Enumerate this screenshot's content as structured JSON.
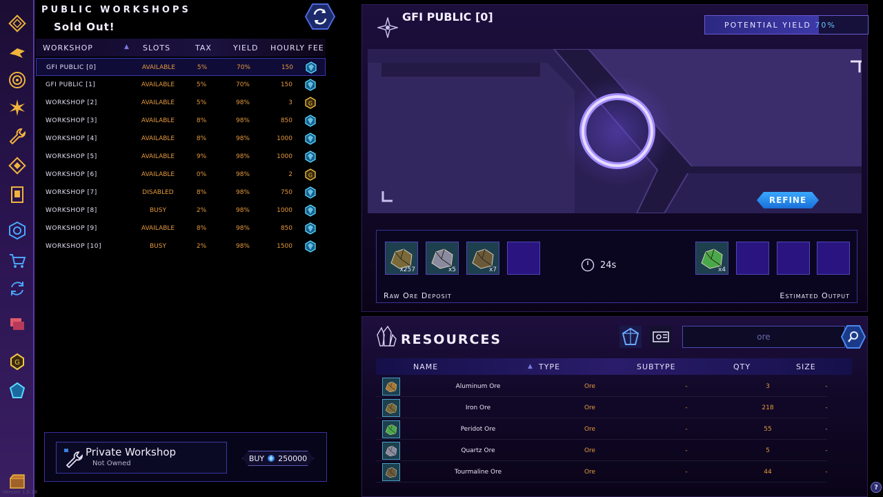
{
  "rail": {
    "icons": [
      "diamond-icon",
      "ship-icon",
      "target-icon",
      "burst-icon",
      "wrench-icon",
      "diamond-outline-icon",
      "card-icon",
      "workshop-icon",
      "cart-icon",
      "exchange-icon",
      "chat-icon",
      "gold-coin-icon",
      "blue-crystal-icon",
      "chest-icon"
    ]
  },
  "workshops": {
    "title": "PUBLIC WORKSHOPS",
    "subtitle": "Sold Out!",
    "columns": {
      "name": "WORKSHOP",
      "slots": "SLOTS",
      "tax": "TAX",
      "yield": "YIELD",
      "fee": "HOURLY FEE"
    },
    "rows": [
      {
        "name": "GFI PUBLIC [0]",
        "slots": "AVAILABLE",
        "tax": "5%",
        "yield": "70%",
        "fee": "150",
        "currency": "crystal",
        "selected": true
      },
      {
        "name": "GFI PUBLIC [1]",
        "slots": "AVAILABLE",
        "tax": "5%",
        "yield": "70%",
        "fee": "150",
        "currency": "crystal"
      },
      {
        "name": "WORKSHOP [2]",
        "slots": "AVAILABLE",
        "tax": "5%",
        "yield": "98%",
        "fee": "3",
        "currency": "gold"
      },
      {
        "name": "WORKSHOP [3]",
        "slots": "AVAILABLE",
        "tax": "8%",
        "yield": "98%",
        "fee": "850",
        "currency": "crystal"
      },
      {
        "name": "WORKSHOP [4]",
        "slots": "AVAILABLE",
        "tax": "8%",
        "yield": "98%",
        "fee": "1000",
        "currency": "crystal"
      },
      {
        "name": "WORKSHOP [5]",
        "slots": "AVAILABLE",
        "tax": "9%",
        "yield": "98%",
        "fee": "1000",
        "currency": "crystal"
      },
      {
        "name": "WORKSHOP [6]",
        "slots": "AVAILABLE",
        "tax": "0%",
        "yield": "98%",
        "fee": "2",
        "currency": "gold"
      },
      {
        "name": "WORKSHOP [7]",
        "slots": "DISABLED",
        "tax": "8%",
        "yield": "98%",
        "fee": "750",
        "currency": "crystal"
      },
      {
        "name": "WORKSHOP [8]",
        "slots": "BUSY",
        "tax": "2%",
        "yield": "98%",
        "fee": "1000",
        "currency": "crystal"
      },
      {
        "name": "WORKSHOP [9]",
        "slots": "AVAILABLE",
        "tax": "8%",
        "yield": "98%",
        "fee": "850",
        "currency": "crystal"
      },
      {
        "name": "WORKSHOP [10]",
        "slots": "BUSY",
        "tax": "2%",
        "yield": "98%",
        "fee": "1500",
        "currency": "crystal"
      }
    ]
  },
  "private_workshop": {
    "title": "Private Workshop",
    "status": "Not Owned",
    "buy_label": "BUY",
    "price": "250000"
  },
  "main": {
    "title": "GFI PUBLIC [0]",
    "potential_yield_label": "POTENTIAL YIELD",
    "potential_yield_value": "70%",
    "potential_yield_fraction": 0.7,
    "refine_label": "REFINE",
    "timer": "24s",
    "raw_label": "Raw Ore Deposit",
    "output_label": "Estimated Output",
    "input_slots": [
      {
        "count": "x257",
        "ore": "Iron Ore"
      },
      {
        "count": "x5",
        "ore": "Quartz Ore"
      },
      {
        "count": "x7",
        "ore": "Tourmaline Ore"
      }
    ],
    "output_slots": [
      {
        "count": "x4",
        "ore": "Peridot Ore"
      }
    ]
  },
  "resources": {
    "title": "RESOURCES",
    "search": {
      "value": "ore"
    },
    "columns": {
      "name": "NAME",
      "type": "TYPE",
      "subtype": "SUBTYPE",
      "qty": "QTY",
      "size": "SIZE"
    },
    "rows": [
      {
        "name": "Aluminum Ore",
        "type": "Ore",
        "subtype": "-",
        "qty": "3",
        "size": "-"
      },
      {
        "name": "Iron Ore",
        "type": "Ore",
        "subtype": "-",
        "qty": "218",
        "size": "-"
      },
      {
        "name": "Peridot Ore",
        "type": "Ore",
        "subtype": "-",
        "qty": "55",
        "size": "-"
      },
      {
        "name": "Quartz Ore",
        "type": "Ore",
        "subtype": "-",
        "qty": "5",
        "size": "-"
      },
      {
        "name": "Tourmaline Ore",
        "type": "Ore",
        "subtype": "-",
        "qty": "44",
        "size": "-"
      }
    ]
  },
  "help_label": "?",
  "version": "Version 1.0.18",
  "colors": {
    "accent": "#68c4ff",
    "orange": "#e59a3c",
    "panel": "#1d0f3c",
    "highlight": "#3a38b0"
  }
}
